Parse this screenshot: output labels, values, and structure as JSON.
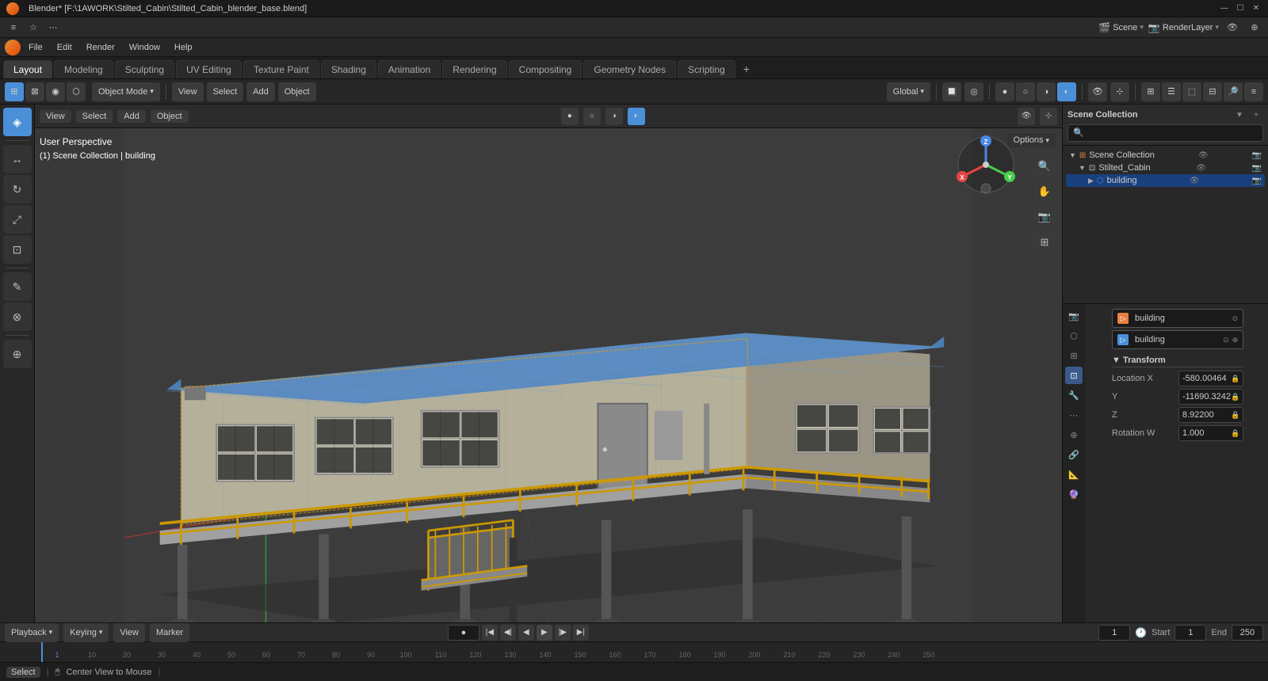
{
  "titlebar": {
    "title": "Blender* [F:\\1AWORK\\Stilted_Cabin\\Stilted_Cabin_blender_base.blend]",
    "minimize": "—",
    "maximize": "☐",
    "close": "✕"
  },
  "menubar": {
    "items": [
      "Blender",
      "File",
      "Edit",
      "Render",
      "Window",
      "Help"
    ]
  },
  "workspace_tabs": {
    "tabs": [
      "Layout",
      "Modeling",
      "Sculpting",
      "UV Editing",
      "Texture Paint",
      "Shading",
      "Animation",
      "Rendering",
      "Compositing",
      "Geometry Nodes",
      "Scripting"
    ],
    "active": "Layout",
    "add": "+"
  },
  "top_toolbar": {
    "mode_btn": "Object Mode",
    "view_btn": "View",
    "select_btn": "Select",
    "add_btn": "Add",
    "object_btn": "Object",
    "global_btn": "Global",
    "icons": [
      "⊞",
      "⊕",
      "◎",
      "≡"
    ]
  },
  "viewport": {
    "perspective_label": "User Perspective",
    "scene_label": "(1) Scene Collection | building",
    "options_btn": "Options"
  },
  "left_toolbar": {
    "tools": [
      {
        "icon": "◈",
        "name": "cursor-tool",
        "active": true
      },
      {
        "icon": "↔",
        "name": "move-tool",
        "active": false
      },
      {
        "icon": "↻",
        "name": "rotate-tool",
        "active": false
      },
      {
        "icon": "⊞",
        "name": "scale-tool",
        "active": false
      },
      {
        "icon": "⊡",
        "name": "transform-tool",
        "active": false
      },
      {
        "icon": "✎",
        "name": "annotate-tool",
        "active": false
      },
      {
        "icon": "⊗",
        "name": "measure-tool",
        "active": false
      },
      {
        "icon": "⊕",
        "name": "add-tool",
        "active": false
      }
    ]
  },
  "right_panel": {
    "scene_collection": "Scene Collection",
    "outliner_items": [
      {
        "name": "Stilted_Cabin",
        "indent": 0,
        "icon": "▷",
        "type": "scene"
      },
      {
        "name": "building",
        "indent": 1,
        "icon": "▷",
        "type": "object",
        "selected": true
      }
    ],
    "search_placeholder": "🔍",
    "properties_tabs": [
      "🎬",
      "🌐",
      "⚙",
      "🔧",
      "💡",
      "📷",
      "🎯",
      "📦",
      "🔮",
      "📐"
    ],
    "active_prop_tab": 3,
    "object_name": "building",
    "transform": {
      "header": "Transform",
      "location_x": "-580.00464",
      "location_y": "-11690.3242",
      "location_z": "8.92200",
      "rotation_w": "1.000"
    }
  },
  "bottom_props": {
    "obj_name1": "building",
    "obj_name2": "building"
  },
  "timeline": {
    "playback_btn": "Playback",
    "keying_btn": "Keying",
    "view_btn": "View",
    "marker_btn": "Marker",
    "current_frame": "1",
    "start_frame": "1",
    "end_frame": "250",
    "start_label": "Start",
    "end_label": "End",
    "frame_marks": [
      "1",
      "10",
      "20",
      "30",
      "40",
      "50",
      "60",
      "70",
      "80",
      "90",
      "100",
      "110",
      "120",
      "130",
      "140",
      "150",
      "160",
      "170",
      "180",
      "190",
      "200",
      "210",
      "220",
      "230",
      "240",
      "250"
    ]
  },
  "status_bar": {
    "select_key": "Select",
    "center_view_text": "Center View to Mouse",
    "separators": [
      "|",
      "|"
    ]
  },
  "gizmo": {
    "x_color": "#e84444",
    "y_color": "#4acd4a",
    "z_color": "#4a88e8"
  },
  "global_header": {
    "scene_icon": "🎬",
    "scene_name": "Scene",
    "layer_icon": "📷",
    "layer_name": "RenderLayer",
    "icon1": "👁",
    "icon2": "⊕"
  }
}
